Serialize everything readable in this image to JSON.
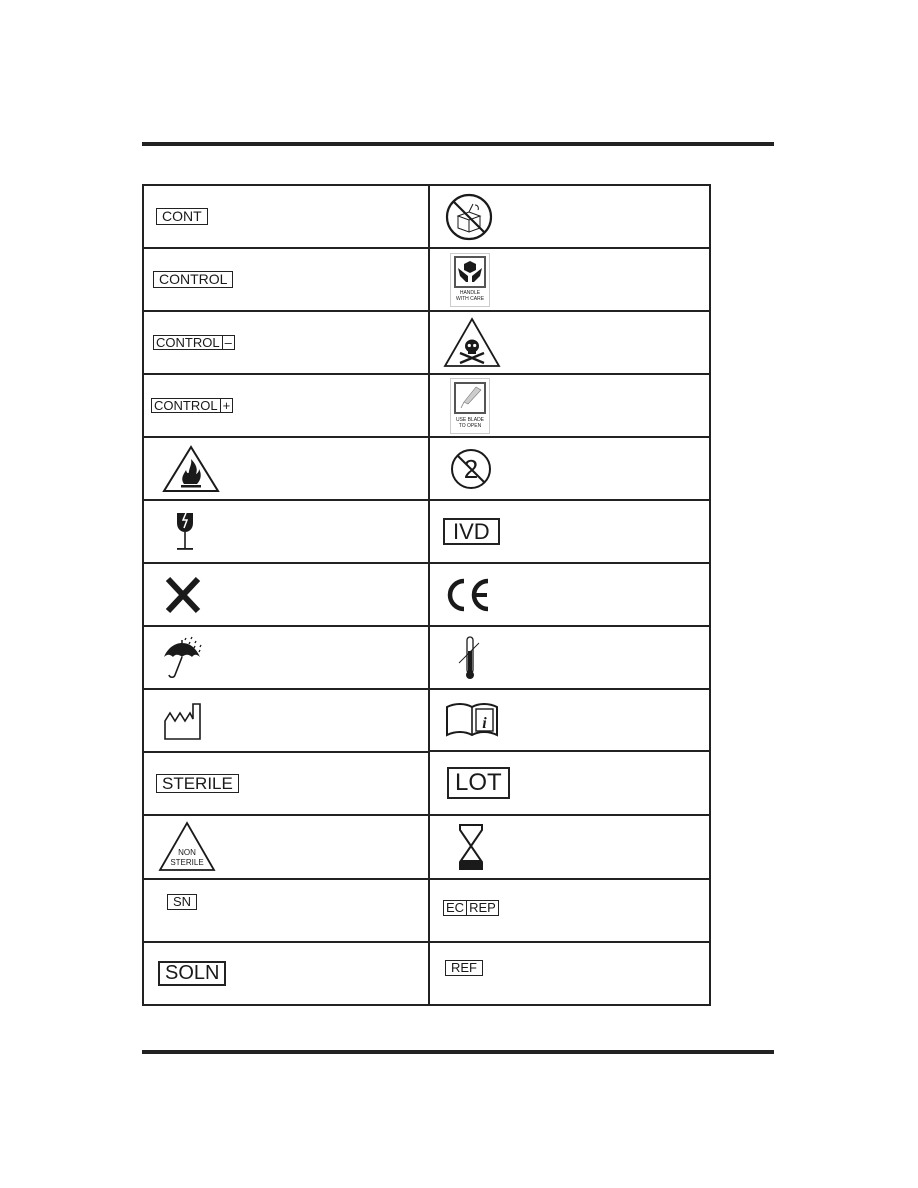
{
  "document": {
    "left_column": [
      {
        "id": "cont",
        "type": "boxed-text",
        "segments": [
          "CONT"
        ]
      },
      {
        "id": "control",
        "type": "boxed-text",
        "segments": [
          "CONTROL"
        ]
      },
      {
        "id": "control-negative",
        "type": "boxed-text",
        "segments": [
          "CONTROL",
          "–"
        ]
      },
      {
        "id": "control-positive",
        "type": "boxed-text",
        "segments": [
          "CONTROL",
          "+"
        ]
      },
      {
        "id": "flammable",
        "type": "icon",
        "icon": "flammable-icon"
      },
      {
        "id": "fragile",
        "type": "icon",
        "icon": "fragile-glass-icon"
      },
      {
        "id": "harmful",
        "type": "icon",
        "icon": "x-cross-icon"
      },
      {
        "id": "keep-dry",
        "type": "icon",
        "icon": "umbrella-rain-icon"
      },
      {
        "id": "manufacturer",
        "type": "icon",
        "icon": "factory-icon"
      },
      {
        "id": "sterile",
        "type": "boxed-text",
        "segments": [
          "STERILE"
        ]
      },
      {
        "id": "non-sterile",
        "type": "triangle-text",
        "lines": [
          "NON",
          "STERILE"
        ]
      },
      {
        "id": "serial-number",
        "type": "boxed-text",
        "segments": [
          "SN"
        ]
      },
      {
        "id": "solution",
        "type": "boxed-text",
        "segments": [
          "SOLN"
        ]
      }
    ],
    "right_column": [
      {
        "id": "do-not-open",
        "type": "icon",
        "icon": "no-open-box-icon"
      },
      {
        "id": "handle-with-care",
        "type": "label-icon",
        "icon": "hands-box-icon",
        "lines": [
          "HANDLE",
          "WITH CARE"
        ]
      },
      {
        "id": "toxic",
        "type": "icon",
        "icon": "skull-crossbones-icon"
      },
      {
        "id": "use-blade",
        "type": "label-icon",
        "icon": "blade-icon",
        "lines": [
          "USE BLADE",
          "TO OPEN"
        ]
      },
      {
        "id": "do-not-reuse",
        "type": "icon",
        "icon": "do-not-reuse-icon"
      },
      {
        "id": "ivd",
        "type": "boxed-text",
        "segments": [
          "IVD"
        ]
      },
      {
        "id": "ce-mark",
        "type": "text-icon",
        "text": "CE"
      },
      {
        "id": "temperature-limit",
        "type": "icon",
        "icon": "thermometer-icon"
      },
      {
        "id": "consult-instructions",
        "type": "icon",
        "icon": "book-info-icon"
      },
      {
        "id": "lot",
        "type": "boxed-text",
        "segments": [
          "LOT"
        ]
      },
      {
        "id": "use-by",
        "type": "icon",
        "icon": "hourglass-icon"
      },
      {
        "id": "ec-rep",
        "type": "boxed-text",
        "segments": [
          "EC",
          "REP"
        ]
      },
      {
        "id": "ref",
        "type": "boxed-text",
        "segments": [
          "REF"
        ]
      }
    ]
  }
}
